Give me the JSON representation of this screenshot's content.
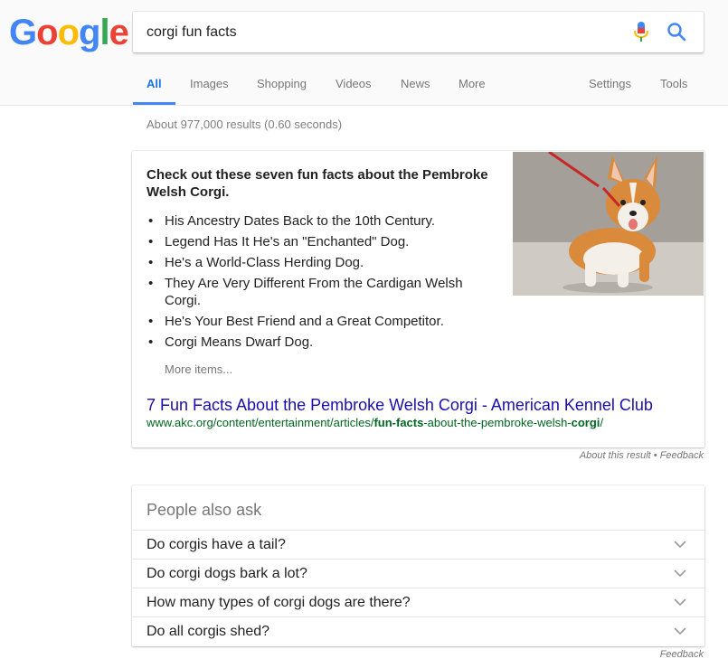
{
  "logo": {
    "letters": [
      "G",
      "o",
      "o",
      "g",
      "l",
      "e"
    ],
    "colors": [
      "#4285f4",
      "#ea4335",
      "#fbbc05",
      "#4285f4",
      "#34a853",
      "#ea4335"
    ]
  },
  "search": {
    "query": "corgi fun facts",
    "mic_icon": "mic-icon",
    "search_icon": "search-icon"
  },
  "tabs": [
    {
      "label": "All",
      "active": true
    },
    {
      "label": "Images"
    },
    {
      "label": "Shopping"
    },
    {
      "label": "Videos"
    },
    {
      "label": "News"
    },
    {
      "label": "More"
    },
    {
      "label": "Settings"
    },
    {
      "label": "Tools"
    }
  ],
  "stats": "About 977,000 results (0.60 seconds)",
  "featured": {
    "heading": "Check out these seven fun facts about the Pembroke Welsh Corgi.",
    "facts": [
      "His Ancestry Dates Back to the 10th Century.",
      "Legend Has It He's an \"Enchanted\" Dog.",
      "He's a World-Class Herding Dog.",
      "They Are Very Different From the Cardigan Welsh Corgi.",
      "He's Your Best Friend and a Great Competitor.",
      "Corgi Means Dwarf Dog."
    ],
    "more_items": "More items...",
    "result_title": "7 Fun Facts About the Pembroke Welsh Corgi - American Kennel Club",
    "url_parts": {
      "prefix": "www.akc.org/content/entertainment/articles/",
      "bold1": "fun-facts",
      "middle": "-about-the-pembroke-welsh-",
      "bold2": "corgi",
      "suffix": "/"
    }
  },
  "about_result": "About this result",
  "about_sep": " • ",
  "about_feedback": "Feedback",
  "people_also_ask": {
    "title": "People also ask",
    "questions": [
      "Do corgis have a tail?",
      "Do corgi dogs bark a lot?",
      "How many types of corgi dogs are there?",
      "Do all corgis shed?"
    ]
  },
  "feedback": "Feedback",
  "accent_color": "#4285f4",
  "link_color": "#1a0dab",
  "url_color": "#006621"
}
